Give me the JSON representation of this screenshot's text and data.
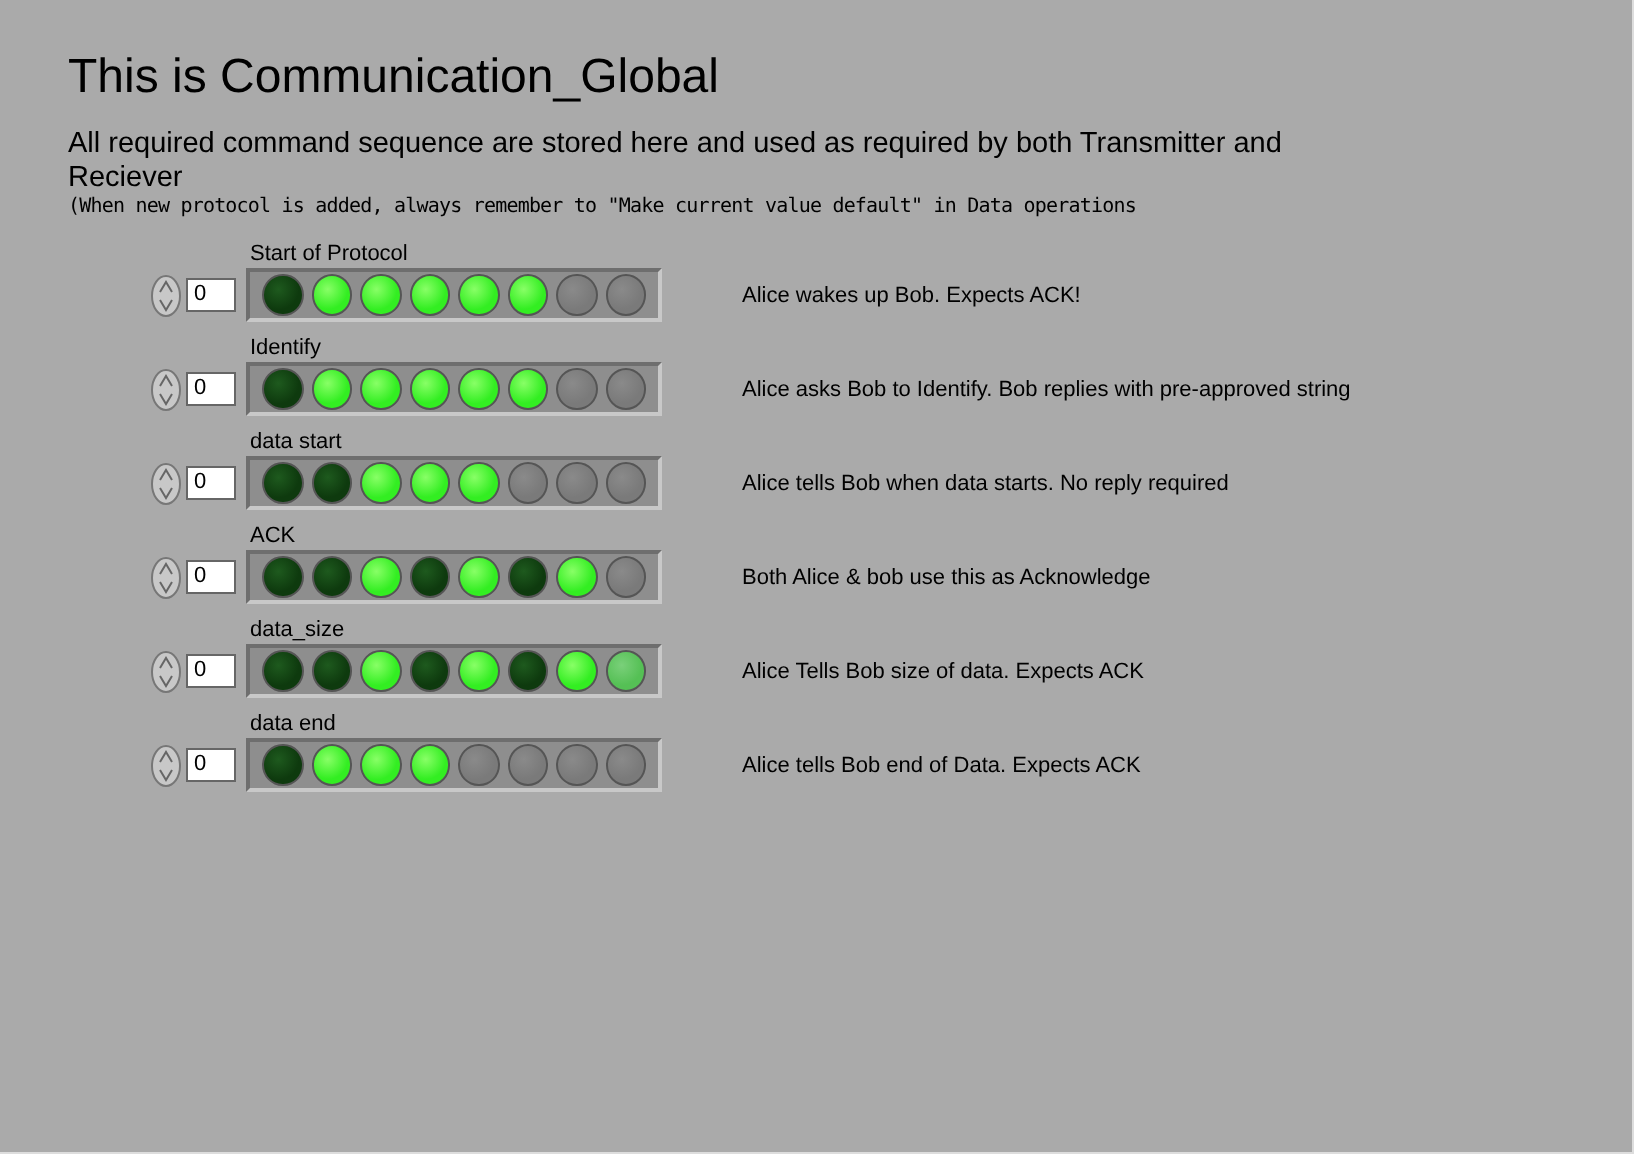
{
  "title": "This is Communication_Global",
  "description": "All required command sequence are stored here and used as required by both Transmitter and Reciever",
  "note": "(When new protocol is added, always remember to \"Make current value default\" in Data operations",
  "arrays": [
    {
      "label": "Start of Protocol",
      "index": "0",
      "leds": [
        {
          "kind": "off"
        },
        {
          "kind": "on"
        },
        {
          "kind": "on"
        },
        {
          "kind": "on"
        },
        {
          "kind": "on"
        },
        {
          "kind": "on"
        },
        {
          "kind": "grey"
        },
        {
          "kind": "grey"
        }
      ],
      "comment": "Alice wakes up Bob. Expects ACK!"
    },
    {
      "label": "Identify",
      "index": "0",
      "leds": [
        {
          "kind": "off"
        },
        {
          "kind": "on"
        },
        {
          "kind": "on"
        },
        {
          "kind": "on"
        },
        {
          "kind": "on"
        },
        {
          "kind": "on"
        },
        {
          "kind": "grey"
        },
        {
          "kind": "grey"
        }
      ],
      "comment": "Alice asks Bob to Identify. Bob replies with pre-approved string"
    },
    {
      "label": "data start",
      "index": "0",
      "leds": [
        {
          "kind": "off"
        },
        {
          "kind": "off"
        },
        {
          "kind": "on"
        },
        {
          "kind": "on"
        },
        {
          "kind": "on"
        },
        {
          "kind": "grey"
        },
        {
          "kind": "grey"
        },
        {
          "kind": "grey"
        }
      ],
      "comment": "Alice tells Bob when data starts. No reply required"
    },
    {
      "label": "ACK",
      "index": "0",
      "leds": [
        {
          "kind": "off"
        },
        {
          "kind": "off"
        },
        {
          "kind": "on"
        },
        {
          "kind": "off"
        },
        {
          "kind": "on"
        },
        {
          "kind": "off"
        },
        {
          "kind": "on"
        },
        {
          "kind": "grey"
        }
      ],
      "comment": "Both Alice & bob use this as Acknowledge"
    },
    {
      "label": "data_size",
      "index": "0",
      "leds": [
        {
          "kind": "off"
        },
        {
          "kind": "off"
        },
        {
          "kind": "on"
        },
        {
          "kind": "off"
        },
        {
          "kind": "on"
        },
        {
          "kind": "off"
        },
        {
          "kind": "on"
        },
        {
          "kind": "dim"
        }
      ],
      "comment": "Alice Tells Bob size of data. Expects ACK"
    },
    {
      "label": "data end",
      "index": "0",
      "leds": [
        {
          "kind": "off"
        },
        {
          "kind": "on"
        },
        {
          "kind": "on"
        },
        {
          "kind": "on"
        },
        {
          "kind": "grey"
        },
        {
          "kind": "grey"
        },
        {
          "kind": "grey"
        },
        {
          "kind": "grey"
        }
      ],
      "comment": "Alice tells Bob end of Data. Expects ACK"
    }
  ]
}
